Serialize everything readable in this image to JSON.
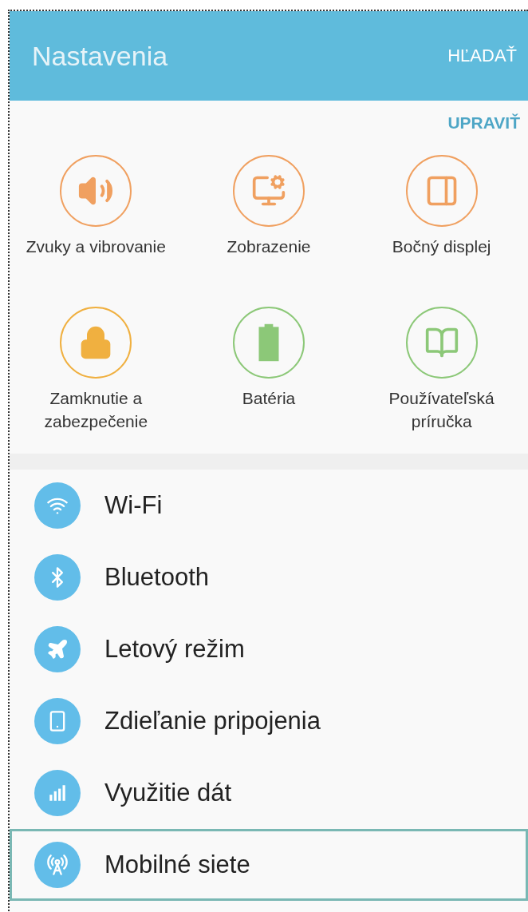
{
  "header": {
    "title": "Nastavenia",
    "search_action": "HĽADAŤ"
  },
  "edit_action": "UPRAVIŤ",
  "quick_settings": [
    {
      "label": "Zvuky a vibrovanie",
      "color": "#f0a060"
    },
    {
      "label": "Zobrazenie",
      "color": "#f0a060"
    },
    {
      "label": "Bočný displej",
      "color": "#f0a060"
    },
    {
      "label": "Zamknutie a zabezpečenie",
      "color": "#f0b040"
    },
    {
      "label": "Batéria",
      "color": "#8cc878"
    },
    {
      "label": "Používateľská príručka",
      "color": "#8cc878"
    }
  ],
  "settings_list": [
    {
      "label": "Wi-Fi",
      "selected": false
    },
    {
      "label": "Bluetooth",
      "selected": false
    },
    {
      "label": "Letový režim",
      "selected": false
    },
    {
      "label": "Zdieľanie pripojenia",
      "selected": false
    },
    {
      "label": "Využitie dát",
      "selected": false
    },
    {
      "label": "Mobilné siete",
      "selected": true
    }
  ]
}
